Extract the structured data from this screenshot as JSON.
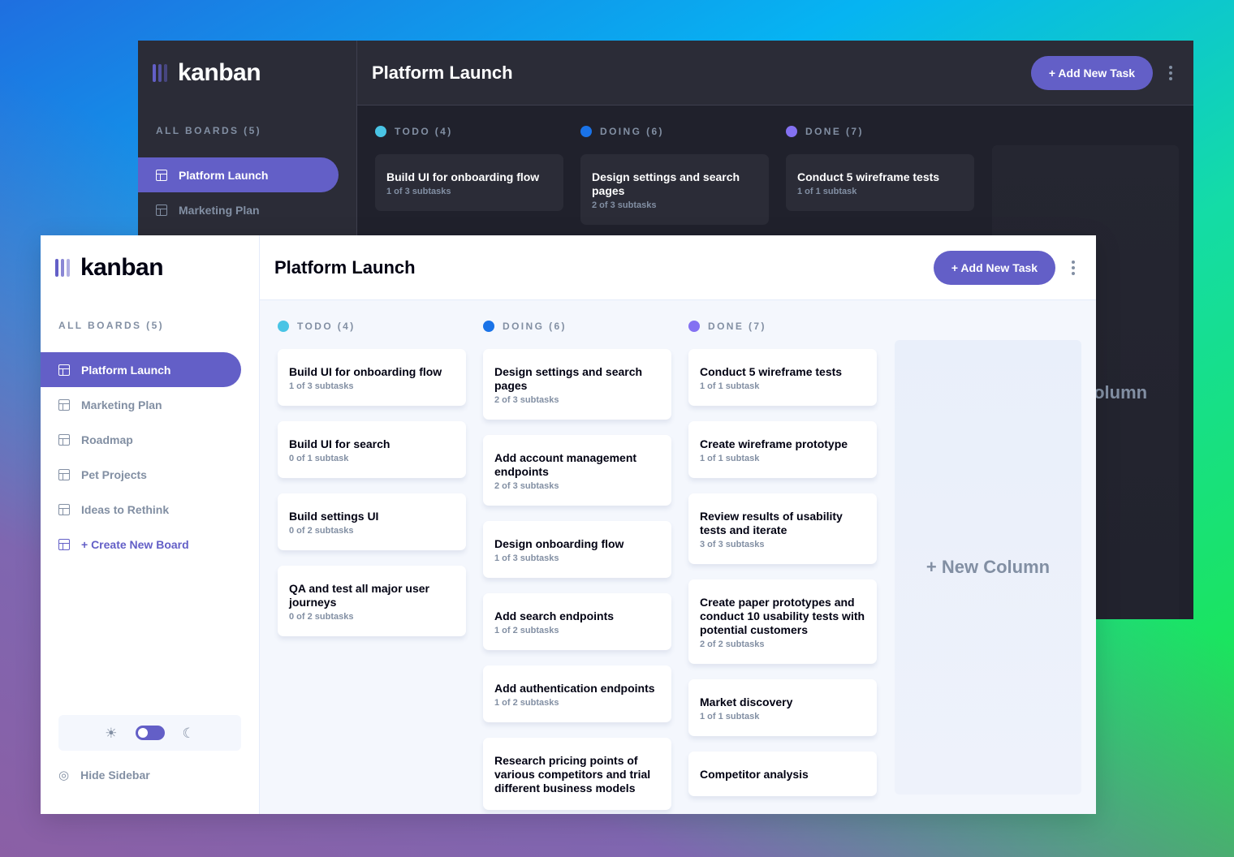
{
  "brand": "kanban",
  "boards_title": "ALL BOARDS (5)",
  "boards": [
    "Platform Launch",
    "Marketing Plan",
    "Roadmap",
    "Pet Projects",
    "Ideas to Rethink"
  ],
  "create_board": "+ Create New Board",
  "header": {
    "title": "Platform Launch",
    "add_task": "+ Add New Task"
  },
  "columns": [
    {
      "title": "TODO (4)",
      "color": "#49c4e5",
      "cards": [
        {
          "title": "Build UI for onboarding flow",
          "sub": "1 of 3 subtasks"
        },
        {
          "title": "Build UI for search",
          "sub": "0 of 1 subtask"
        },
        {
          "title": "Build settings UI",
          "sub": "0 of 2 subtasks"
        },
        {
          "title": "QA and test all major user journeys",
          "sub": "0 of 2 subtasks"
        }
      ]
    },
    {
      "title": "DOING (6)",
      "color": "#1a73e8",
      "cards": [
        {
          "title": "Design settings and search pages",
          "sub": "2 of 3 subtasks"
        },
        {
          "title": "Add account management endpoints",
          "sub": "2 of 3 subtasks"
        },
        {
          "title": "Design onboarding flow",
          "sub": "1 of 3 subtasks"
        },
        {
          "title": "Add search endpoints",
          "sub": "1 of 2 subtasks"
        },
        {
          "title": "Add authentication endpoints",
          "sub": "1 of 2 subtasks"
        },
        {
          "title": "Research pricing points of various competitors and trial different business models",
          "sub": ""
        }
      ]
    },
    {
      "title": "DONE (7)",
      "color": "#8471f2",
      "cards": [
        {
          "title": "Conduct 5 wireframe tests",
          "sub": "1 of 1 subtask"
        },
        {
          "title": "Create wireframe prototype",
          "sub": "1 of 1 subtask"
        },
        {
          "title": "Review results of usability tests and iterate",
          "sub": "3 of 3 subtasks"
        },
        {
          "title": "Create paper prototypes and conduct 10 usability tests with potential customers",
          "sub": "2 of 2 subtasks"
        },
        {
          "title": "Market discovery",
          "sub": "1 of 1 subtask"
        },
        {
          "title": "Competitor analysis",
          "sub": ""
        }
      ]
    }
  ],
  "new_column": "+ New Column",
  "hide_sidebar": "Hide Sidebar",
  "theme": {
    "mode": "light"
  },
  "icons": {
    "sun": "sun-icon",
    "moon": "moon-icon",
    "hide": "eye-slash-icon",
    "board": "board-icon",
    "more": "vertical-ellipsis-icon"
  }
}
